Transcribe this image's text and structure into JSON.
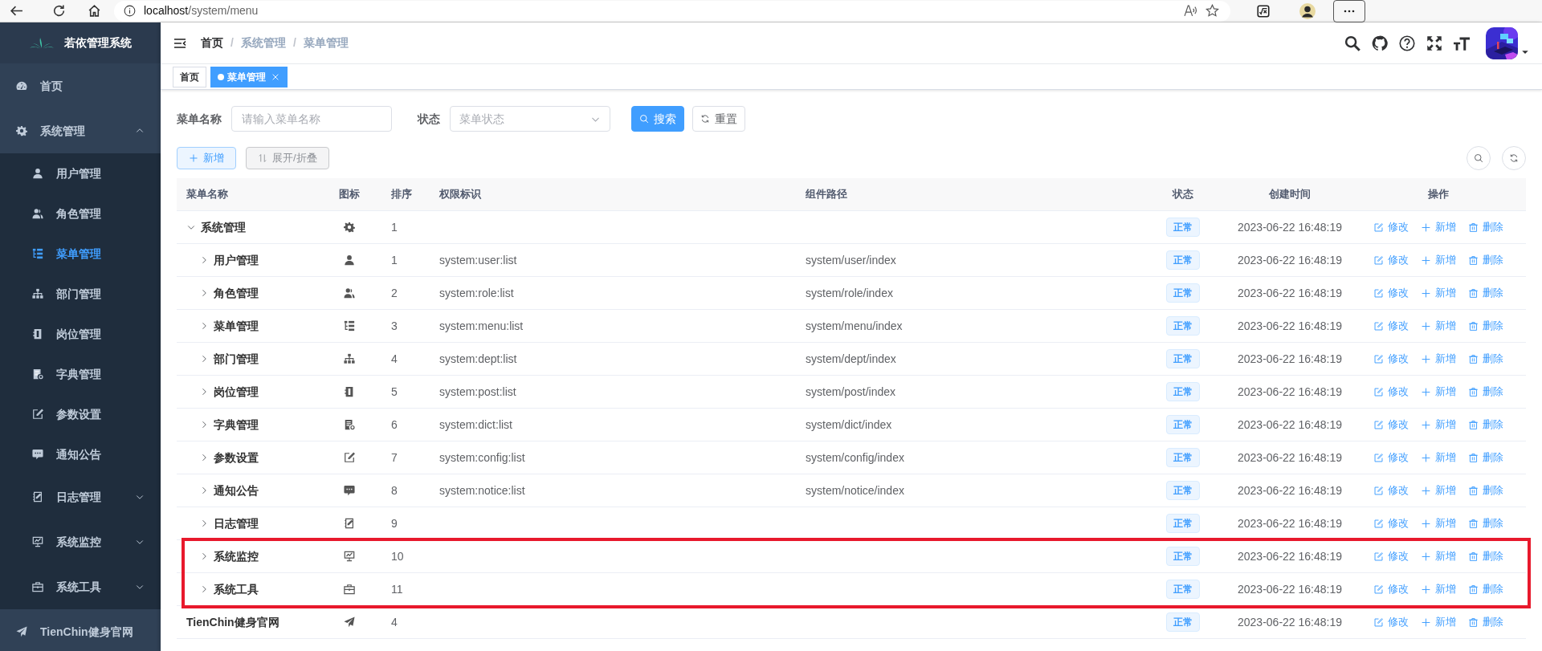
{
  "browser": {
    "url_host": "localhost",
    "url_path": "/system/menu"
  },
  "sidebar": {
    "title": "若依管理系统",
    "items": [
      {
        "label": "首页",
        "selected": false
      },
      {
        "label": "系统管理",
        "selected": false,
        "expanded": true,
        "children": [
          {
            "label": "用户管理",
            "selected": false
          },
          {
            "label": "角色管理",
            "selected": false
          },
          {
            "label": "菜单管理",
            "selected": true
          },
          {
            "label": "部门管理",
            "selected": false
          },
          {
            "label": "岗位管理",
            "selected": false
          },
          {
            "label": "字典管理",
            "selected": false
          },
          {
            "label": "参数设置",
            "selected": false
          },
          {
            "label": "通知公告",
            "selected": false
          },
          {
            "label": "日志管理",
            "selected": false,
            "expanded": false
          },
          {
            "label": "系统监控",
            "selected": false,
            "expanded": false
          },
          {
            "label": "系统工具",
            "selected": false,
            "expanded": false
          }
        ]
      },
      {
        "label": "TienChin健身官网",
        "selected": false
      }
    ]
  },
  "breadcrumb": {
    "separator": "/",
    "items": [
      "首页",
      "系统管理",
      "菜单管理"
    ]
  },
  "tags": [
    {
      "label": "首页",
      "selected": false,
      "closable": false
    },
    {
      "label": "菜单管理",
      "selected": true,
      "closable": true
    }
  ],
  "search_form": {
    "fields": [
      {
        "kind": "input",
        "label": "菜单名称",
        "placeholder": "请输入菜单名称"
      },
      {
        "kind": "select",
        "label": "状态",
        "placeholder": "菜单状态"
      }
    ],
    "buttons": [
      {
        "kind": "primary",
        "label": "搜索"
      },
      {
        "kind": "default",
        "label": "重置"
      }
    ]
  },
  "toolbar": {
    "buttons": [
      {
        "kind": "add",
        "label": "新增"
      },
      {
        "kind": "toggle",
        "label": "展开/折叠"
      }
    ]
  },
  "table": {
    "columns": [
      "菜单名称",
      "图标",
      "排序",
      "权限标识",
      "组件路径",
      "状态",
      "创建时间",
      "操作"
    ],
    "rows": [
      {
        "name": "系统管理",
        "order": "1",
        "status": "正常",
        "created": "2023-06-22 16:48:19",
        "actions": [
          "修改",
          "新增",
          "删除"
        ],
        "has_children": true,
        "expanded": true,
        "highlighted": false,
        "children": [
          {
            "name": "用户管理",
            "order": "1",
            "perms": "system:user:list",
            "component": "system/user/index",
            "status": "正常",
            "created": "2023-06-22 16:48:19",
            "actions": [
              "修改",
              "新增",
              "删除"
            ],
            "has_children": true,
            "expanded": false,
            "highlighted": false
          },
          {
            "name": "角色管理",
            "order": "2",
            "perms": "system:role:list",
            "component": "system/role/index",
            "status": "正常",
            "created": "2023-06-22 16:48:19",
            "actions": [
              "修改",
              "新增",
              "删除"
            ],
            "has_children": true,
            "expanded": false,
            "highlighted": false
          },
          {
            "name": "菜单管理",
            "order": "3",
            "perms": "system:menu:list",
            "component": "system/menu/index",
            "status": "正常",
            "created": "2023-06-22 16:48:19",
            "actions": [
              "修改",
              "新增",
              "删除"
            ],
            "has_children": true,
            "expanded": false,
            "highlighted": false
          },
          {
            "name": "部门管理",
            "order": "4",
            "perms": "system:dept:list",
            "component": "system/dept/index",
            "status": "正常",
            "created": "2023-06-22 16:48:19",
            "actions": [
              "修改",
              "新增",
              "删除"
            ],
            "has_children": true,
            "expanded": false,
            "highlighted": false
          },
          {
            "name": "岗位管理",
            "order": "5",
            "perms": "system:post:list",
            "component": "system/post/index",
            "status": "正常",
            "created": "2023-06-22 16:48:19",
            "actions": [
              "修改",
              "新增",
              "删除"
            ],
            "has_children": true,
            "expanded": false,
            "highlighted": false
          },
          {
            "name": "字典管理",
            "order": "6",
            "perms": "system:dict:list",
            "component": "system/dict/index",
            "status": "正常",
            "created": "2023-06-22 16:48:19",
            "actions": [
              "修改",
              "新增",
              "删除"
            ],
            "has_children": true,
            "expanded": false,
            "highlighted": false
          },
          {
            "name": "参数设置",
            "order": "7",
            "perms": "system:config:list",
            "component": "system/config/index",
            "status": "正常",
            "created": "2023-06-22 16:48:19",
            "actions": [
              "修改",
              "新增",
              "删除"
            ],
            "has_children": true,
            "expanded": false,
            "highlighted": false
          },
          {
            "name": "通知公告",
            "order": "8",
            "perms": "system:notice:list",
            "component": "system/notice/index",
            "status": "正常",
            "created": "2023-06-22 16:48:19",
            "actions": [
              "修改",
              "新增",
              "删除"
            ],
            "has_children": true,
            "expanded": false,
            "highlighted": false
          },
          {
            "name": "日志管理",
            "order": "9",
            "status": "正常",
            "created": "2023-06-22 16:48:19",
            "actions": [
              "修改",
              "新增",
              "删除"
            ],
            "has_children": true,
            "expanded": false,
            "highlighted": false
          },
          {
            "name": "系统监控",
            "order": "10",
            "status": "正常",
            "created": "2023-06-22 16:48:19",
            "actions": [
              "修改",
              "新增",
              "删除"
            ],
            "has_children": true,
            "expanded": false,
            "highlighted": true
          },
          {
            "name": "系统工具",
            "order": "11",
            "status": "正常",
            "created": "2023-06-22 16:48:19",
            "actions": [
              "修改",
              "新增",
              "删除"
            ],
            "has_children": true,
            "expanded": false,
            "highlighted": true
          }
        ]
      },
      {
        "name": "TienChin健身官网",
        "order": "4",
        "status": "正常",
        "created": "2023-06-22 16:48:19",
        "actions": [
          "修改",
          "新增",
          "删除"
        ],
        "has_children": false,
        "highlighted": false
      }
    ]
  }
}
